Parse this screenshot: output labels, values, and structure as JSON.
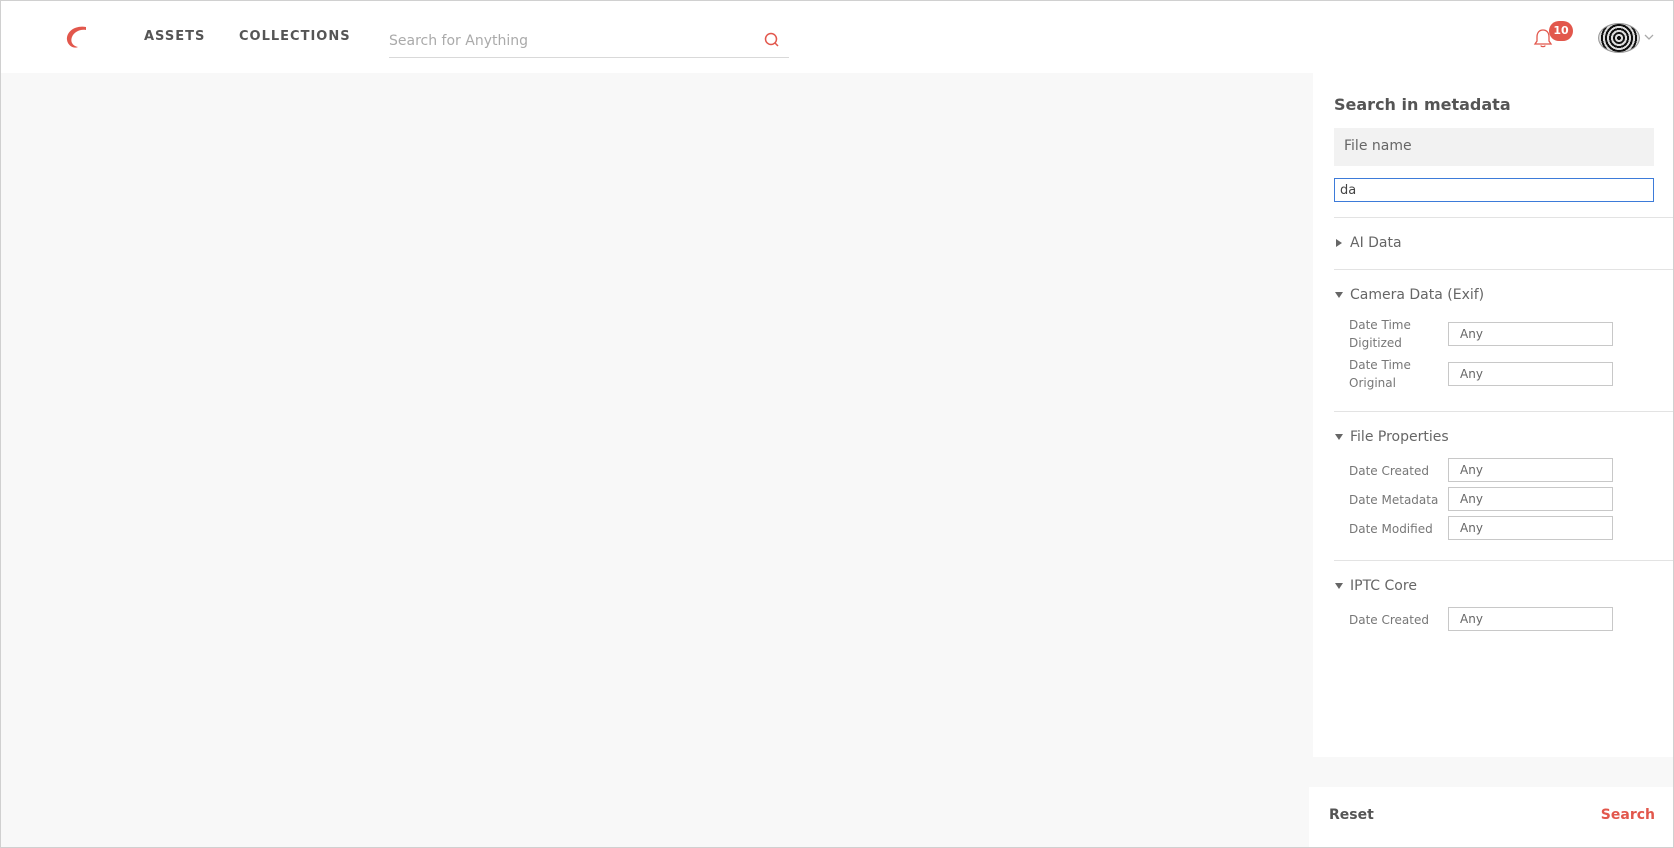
{
  "header": {
    "nav": {
      "assets": "ASSETS",
      "collections": "COLLECTIONS"
    },
    "search_placeholder": "Search for Anything",
    "notification_count": "10",
    "brand_color": "#e2574c"
  },
  "panel": {
    "title": "Search in metadata",
    "file_name_label": "File name",
    "file_name_value": "da",
    "sections": {
      "ai_data": "AI Data",
      "camera": "Camera Data (Exif)",
      "file_props": "File Properties",
      "iptc": "IPTC Core"
    },
    "camera_fields": {
      "dt_digitized": "Date Time Digitized",
      "dt_original": "Date Time Original"
    },
    "file_fields": {
      "date_created": "Date Created",
      "date_metadata": "Date Metadata",
      "date_modified": "Date Modified"
    },
    "iptc_fields": {
      "date_created": "Date Created"
    },
    "any_placeholder": "Any"
  },
  "footer": {
    "reset": "Reset",
    "search": "Search"
  }
}
